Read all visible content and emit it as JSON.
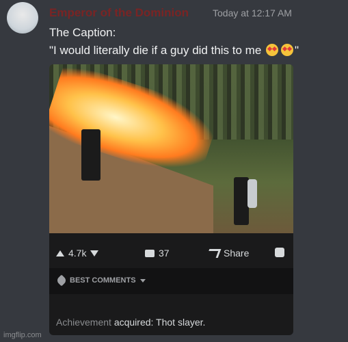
{
  "message": {
    "username": "Emperor of the Dominion",
    "timestamp": "Today at 12:17 AM",
    "line1": "The Caption:",
    "line2_text": "\"I would literally die if a guy did this to me",
    "line2_end": "\"",
    "emoji": "heart-eyes-emoji"
  },
  "post": {
    "image_description_icon": "flamethrower-photo",
    "upvotes": "4.7k",
    "comments": "37",
    "share_label": "Share",
    "best_comments_label": "BEST COMMENTS",
    "comment_prefix": "Achievement",
    "comment_rest": " acquired: Thot slayer."
  },
  "watermark": "imgflip.com",
  "colors": {
    "background": "#36393f",
    "username": "#7a2424",
    "post_bg": "#1a1a1b"
  }
}
